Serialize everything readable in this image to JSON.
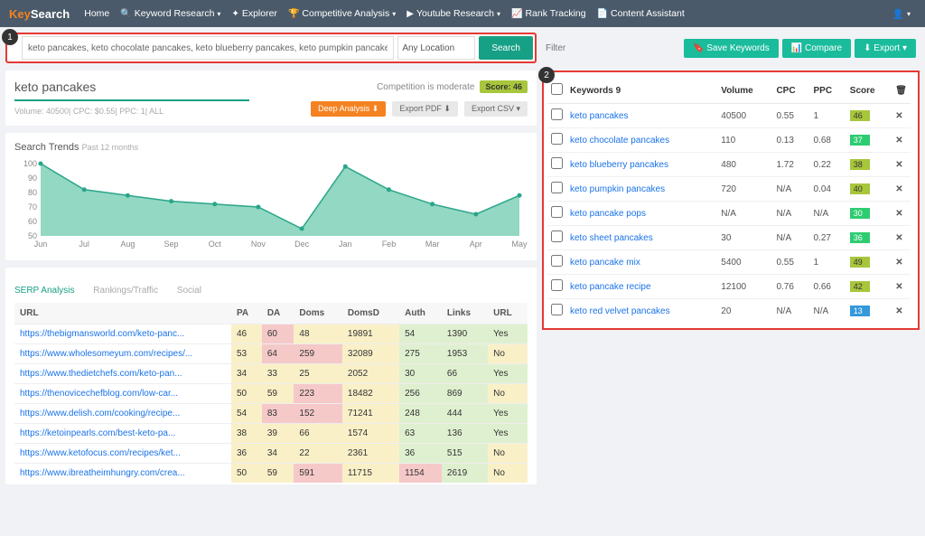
{
  "nav": {
    "logo_a": "Key",
    "logo_b": "Search",
    "home": "Home",
    "kw_research": "Keyword Research",
    "explorer": "Explorer",
    "competitive": "Competitive Analysis",
    "youtube": "Youtube Research",
    "rank": "Rank Tracking",
    "content": "Content Assistant"
  },
  "search": {
    "step": "1",
    "value": "keto pancakes, keto chocolate pancakes, keto blueberry pancakes, keto pumpkin pancakes, keto pan",
    "location": "Any Location",
    "btn": "Search"
  },
  "header": {
    "kw": "keto pancakes",
    "comp": "Competition is moderate",
    "score_label": "Score: 46",
    "meta": "Volume: 40500| CPC: $0.55| PPC: 1| ALL",
    "deep": "Deep Analysis",
    "pdf": "Export PDF",
    "csv": "Export CSV"
  },
  "trends": {
    "title": "Search Trends",
    "sub": "Past 12 months"
  },
  "chart_data": {
    "type": "area",
    "categories": [
      "Jun",
      "Jul",
      "Aug",
      "Sep",
      "Oct",
      "Nov",
      "Dec",
      "Jan",
      "Feb",
      "Mar",
      "Apr",
      "May"
    ],
    "values": [
      100,
      82,
      78,
      74,
      72,
      70,
      55,
      98,
      82,
      72,
      65,
      78
    ],
    "ylim": [
      50,
      100
    ],
    "yticks": [
      100,
      90,
      80,
      70,
      60,
      50
    ],
    "title": "",
    "xlabel": "",
    "ylabel": ""
  },
  "tabs": {
    "serp": "SERP Analysis",
    "rank": "Rankings/Traffic",
    "social": "Social"
  },
  "serp_cols": {
    "url": "URL",
    "pa": "PA",
    "da": "DA",
    "doms": "Doms",
    "domsd": "DomsD",
    "auth": "Auth",
    "links": "Links",
    "url2": "URL"
  },
  "serp_rows": [
    {
      "url": "https://thebigmansworld.com/keto-panc...",
      "pa": "46",
      "pa_c": "y",
      "da": "60",
      "da_c": "r",
      "doms": "48",
      "doms_c": "y",
      "domsd": "19891",
      "domsd_c": "y",
      "auth": "54",
      "auth_c": "g",
      "links": "1390",
      "links_c": "g",
      "u2": "Yes",
      "u2_c": "g"
    },
    {
      "url": "https://www.wholesomeyum.com/recipes/...",
      "pa": "53",
      "pa_c": "y",
      "da": "64",
      "da_c": "r",
      "doms": "259",
      "doms_c": "r",
      "domsd": "32089",
      "domsd_c": "y",
      "auth": "275",
      "auth_c": "g",
      "links": "1953",
      "links_c": "g",
      "u2": "No",
      "u2_c": "y"
    },
    {
      "url": "https://www.thedietchefs.com/keto-pan...",
      "pa": "34",
      "pa_c": "y",
      "da": "33",
      "da_c": "y",
      "doms": "25",
      "doms_c": "y",
      "domsd": "2052",
      "domsd_c": "y",
      "auth": "30",
      "auth_c": "g",
      "links": "66",
      "links_c": "g",
      "u2": "Yes",
      "u2_c": "g"
    },
    {
      "url": "https://thenovicechefblog.com/low-car...",
      "pa": "50",
      "pa_c": "y",
      "da": "59",
      "da_c": "y",
      "doms": "223",
      "doms_c": "r",
      "domsd": "18482",
      "domsd_c": "y",
      "auth": "256",
      "auth_c": "g",
      "links": "869",
      "links_c": "g",
      "u2": "No",
      "u2_c": "y"
    },
    {
      "url": "https://www.delish.com/cooking/recipe...",
      "pa": "54",
      "pa_c": "y",
      "da": "83",
      "da_c": "r",
      "doms": "152",
      "doms_c": "r",
      "domsd": "71241",
      "domsd_c": "y",
      "auth": "248",
      "auth_c": "g",
      "links": "444",
      "links_c": "g",
      "u2": "Yes",
      "u2_c": "g"
    },
    {
      "url": "https://ketoinpearls.com/best-keto-pa...",
      "pa": "38",
      "pa_c": "y",
      "da": "39",
      "da_c": "y",
      "doms": "66",
      "doms_c": "y",
      "domsd": "1574",
      "domsd_c": "y",
      "auth": "63",
      "auth_c": "g",
      "links": "136",
      "links_c": "g",
      "u2": "Yes",
      "u2_c": "g"
    },
    {
      "url": "https://www.ketofocus.com/recipes/ket...",
      "pa": "36",
      "pa_c": "y",
      "da": "34",
      "da_c": "y",
      "doms": "22",
      "doms_c": "y",
      "domsd": "2361",
      "domsd_c": "y",
      "auth": "36",
      "auth_c": "g",
      "links": "515",
      "links_c": "g",
      "u2": "No",
      "u2_c": "y"
    },
    {
      "url": "https://www.ibreatheimhungry.com/crea...",
      "pa": "50",
      "pa_c": "y",
      "da": "59",
      "da_c": "y",
      "doms": "591",
      "doms_c": "r",
      "domsd": "11715",
      "domsd_c": "y",
      "auth": "1154",
      "auth_c": "r",
      "links": "2619",
      "links_c": "g",
      "u2": "No",
      "u2_c": "y"
    }
  ],
  "right": {
    "filter": "Filter",
    "save": "Save Keywords",
    "compare": "Compare",
    "export": "Export",
    "step": "2"
  },
  "kw_head": {
    "kw": "Keywords 9",
    "vol": "Volume",
    "cpc": "CPC",
    "ppc": "PPC",
    "score": "Score"
  },
  "kw_rows": [
    {
      "kw": "keto pancakes",
      "vol": "40500",
      "cpc": "0.55",
      "ppc": "1",
      "score": "46",
      "sc": "y"
    },
    {
      "kw": "keto chocolate pancakes",
      "vol": "110",
      "cpc": "0.13",
      "ppc": "0.68",
      "score": "37",
      "sc": "g"
    },
    {
      "kw": "keto blueberry pancakes",
      "vol": "480",
      "cpc": "1.72",
      "ppc": "0.22",
      "score": "38",
      "sc": "y"
    },
    {
      "kw": "keto pumpkin pancakes",
      "vol": "720",
      "cpc": "N/A",
      "ppc": "0.04",
      "score": "40",
      "sc": "y"
    },
    {
      "kw": "keto pancake pops",
      "vol": "N/A",
      "cpc": "N/A",
      "ppc": "N/A",
      "score": "30",
      "sc": "g"
    },
    {
      "kw": "keto sheet pancakes",
      "vol": "30",
      "cpc": "N/A",
      "ppc": "0.27",
      "score": "36",
      "sc": "g"
    },
    {
      "kw": "keto pancake mix",
      "vol": "5400",
      "cpc": "0.55",
      "ppc": "1",
      "score": "49",
      "sc": "y"
    },
    {
      "kw": "keto pancake recipe",
      "vol": "12100",
      "cpc": "0.76",
      "ppc": "0.66",
      "score": "42",
      "sc": "y"
    },
    {
      "kw": "keto red velvet pancakes",
      "vol": "20",
      "cpc": "N/A",
      "ppc": "N/A",
      "score": "13",
      "sc": "b"
    }
  ]
}
